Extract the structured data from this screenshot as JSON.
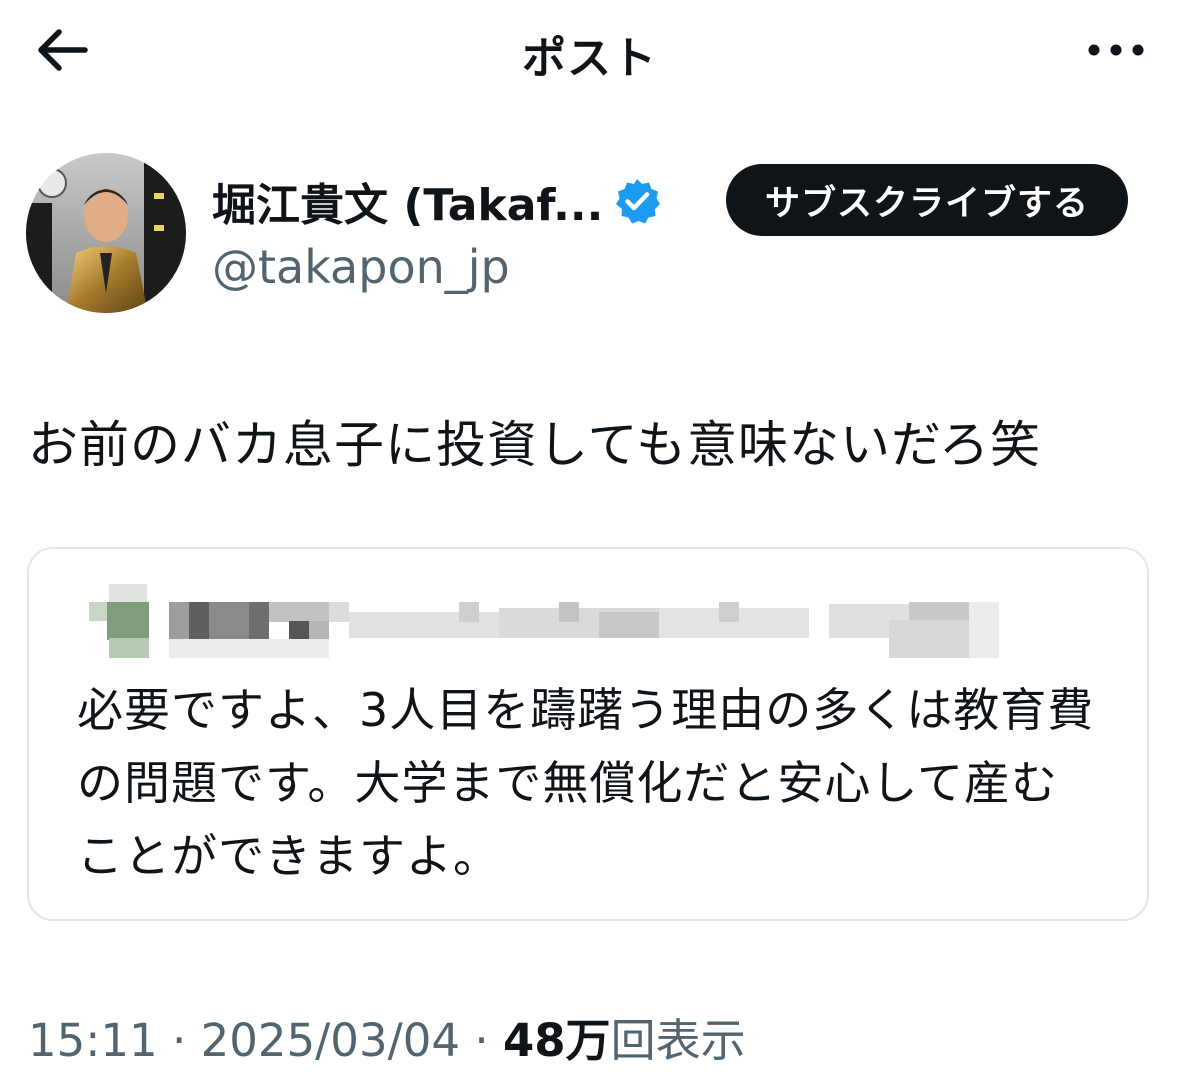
{
  "header": {
    "title": "ポスト",
    "back_icon": "arrow-left-icon",
    "more_icon": "more-horizontal-icon"
  },
  "author": {
    "name": "堀江貴文 (Takaf...",
    "handle": "@takapon_jp",
    "verified_icon": "verified-badge-icon",
    "verified_color": "#1d9bf0",
    "subscribe_label": "サブスクライブする"
  },
  "post": {
    "text": "お前のバカ息子に投資しても意味ないだろ笑"
  },
  "quoted_post": {
    "text": "必要ですよ、3人目を躊躇う理由の多くは教育費の問題です。大学まで無償化だと安心して産むことができますよ。"
  },
  "meta": {
    "time": "15:11",
    "separator": "·",
    "date": "2025/03/04",
    "views_count": "48万",
    "views_label": "回表示"
  },
  "colors": {
    "text_primary": "#0f1419",
    "text_secondary": "#536471",
    "border": "#e1e6ea"
  }
}
